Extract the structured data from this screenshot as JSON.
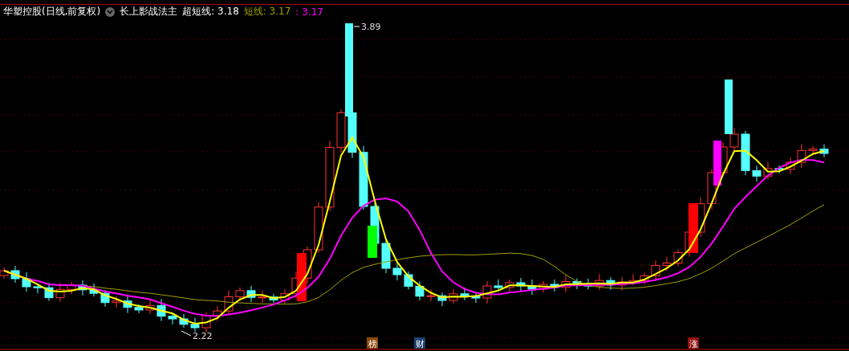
{
  "header": {
    "stock": "华塑控股(日线,前复权)",
    "indicator": "长上影战法主",
    "values": [
      {
        "label": "超短线: 3.18",
        "color": "#ffffff"
      },
      {
        "label": "短线: 3.17",
        "color": "#a0a000"
      },
      {
        "label": ": 3.17",
        "color": "#ff00ff"
      }
    ]
  },
  "chart": {
    "high_label": "3.89",
    "low_label": "2.22"
  },
  "markers": [
    {
      "label": "榜",
      "color": "#8b4a0a"
    },
    {
      "label": "财",
      "color": "#1c3f6e"
    },
    {
      "label": "涨",
      "color": "#8b1010"
    }
  ]
}
